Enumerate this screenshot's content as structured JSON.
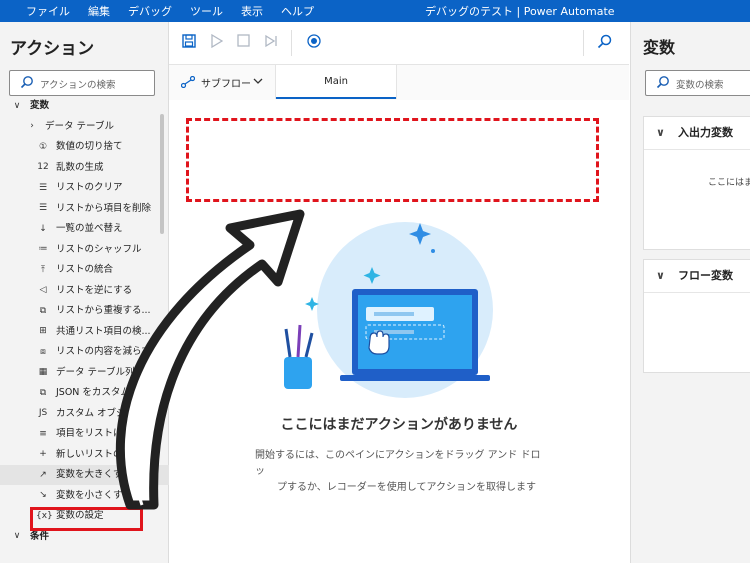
{
  "menubar": {
    "items": [
      "ファイル",
      "編集",
      "デバッグ",
      "ツール",
      "表示",
      "ヘルプ"
    ],
    "title": "デバッグのテスト | Power Automate"
  },
  "actions_pane": {
    "title": "アクション",
    "search_placeholder": "アクションの検索",
    "tree": [
      {
        "label": "変数",
        "icon": "chevron-down-icon",
        "glyph": "∨"
      },
      {
        "label": "データ テーブル",
        "icon": "chevron-right-icon",
        "glyph": "›"
      },
      {
        "label": "数値の切り捨て",
        "icon": "round-number-icon",
        "glyph": "①"
      },
      {
        "label": "乱数の生成",
        "icon": "random-number-icon",
        "glyph": "12"
      },
      {
        "label": "リストのクリア",
        "icon": "clear-list-icon",
        "glyph": "☰"
      },
      {
        "label": "リストから項目を削除",
        "icon": "remove-list-item-icon",
        "glyph": "☰"
      },
      {
        "label": "一覧の並べ替え",
        "icon": "sort-list-icon",
        "glyph": "↓"
      },
      {
        "label": "リストのシャッフル",
        "icon": "shuffle-list-icon",
        "glyph": "≔"
      },
      {
        "label": "リストの統合",
        "icon": "merge-list-icon",
        "glyph": "⤒"
      },
      {
        "label": "リストを逆にする",
        "icon": "reverse-list-icon",
        "glyph": "◁"
      },
      {
        "label": "リストから重複する...",
        "icon": "dedupe-list-icon",
        "glyph": "⧉"
      },
      {
        "label": "共通リスト項目の検...",
        "icon": "common-items-icon",
        "glyph": "⊞"
      },
      {
        "label": "リストの内容を減らす",
        "icon": "subtract-list-icon",
        "glyph": "⧈"
      },
      {
        "label": "データ テーブル列を...",
        "icon": "datatable-column-icon",
        "glyph": "▦"
      },
      {
        "label": "JSON をカスタム オ...",
        "icon": "json-icon",
        "glyph": "⧉"
      },
      {
        "label": "カスタム オブジェク...",
        "icon": "custom-object-icon",
        "glyph": "JS"
      },
      {
        "label": "項目をリストに追加",
        "icon": "add-item-icon",
        "glyph": "≡"
      },
      {
        "label": "新しいリストの作成",
        "icon": "new-list-icon",
        "glyph": "+"
      },
      {
        "label": "変数を大きくする",
        "icon": "increase-variable-icon",
        "glyph": "↗"
      },
      {
        "label": "変数を小さくする",
        "icon": "decrease-variable-icon",
        "glyph": "↘"
      },
      {
        "label": "変数の設定",
        "icon": "set-variable-icon",
        "glyph": "{x}"
      },
      {
        "label": "条件",
        "icon": "chevron-down-icon",
        "glyph": "∨"
      }
    ]
  },
  "tabs": {
    "subflow_label": "サブフロー",
    "main_label": "Main"
  },
  "canvas": {
    "empty_title": "ここにはまだアクションがありません",
    "empty_desc_1": "開始するには、このペインにアクションをドラッグ アンド ドロッ",
    "empty_desc_2": "プするか、レコーダーを使用してアクションを取得します"
  },
  "variables_pane": {
    "title": "変数",
    "search_placeholder": "変数の検索",
    "io_header": "入出力変数",
    "io_body": "ここにはま",
    "flow_header": "フロー変数"
  },
  "colors": {
    "brand": "#0b63c6",
    "annotation": "#e0141c"
  }
}
